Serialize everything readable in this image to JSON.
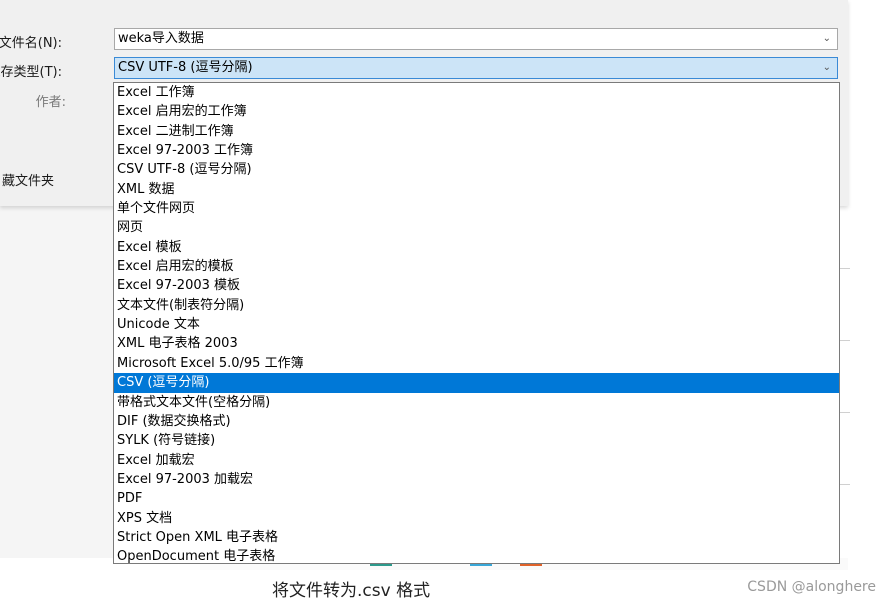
{
  "dialog": {
    "filename_label": "文件名(N):",
    "filename_value": "weka导入数据",
    "savetype_label": "保存类型(T):",
    "savetype_value": "CSV UTF-8 (逗号分隔)",
    "author_label": "作者:",
    "folder_label": "藏文件夹",
    "chevron_icon": "chevron-down-icon"
  },
  "dropdown": {
    "selected_index": 15,
    "options": [
      "Excel 工作簿",
      "Excel 启用宏的工作簿",
      "Excel 二进制工作簿",
      "Excel 97-2003 工作簿",
      "CSV UTF-8 (逗号分隔)",
      "XML 数据",
      "单个文件网页",
      "网页",
      "Excel 模板",
      "Excel 启用宏的模板",
      "Excel 97-2003 模板",
      "文本文件(制表符分隔)",
      "Unicode 文本",
      "XML 电子表格 2003",
      "Microsoft Excel 5.0/95 工作簿",
      "CSV (逗号分隔)",
      "带格式文本文件(空格分隔)",
      "DIF (数据交换格式)",
      "SYLK (符号链接)",
      "Excel 加载宏",
      "Excel 97-2003 加载宏",
      "PDF",
      "XPS 文档",
      "Strict Open XML 电子表格",
      "OpenDocument 电子表格"
    ]
  },
  "caption": "将文件转为.csv 格式",
  "watermark": "CSDN @alonghere",
  "colors": {
    "selection": "#0078d7",
    "field_selected_bg": "#cce4f7",
    "dialog_bg": "#f0f0f0"
  }
}
